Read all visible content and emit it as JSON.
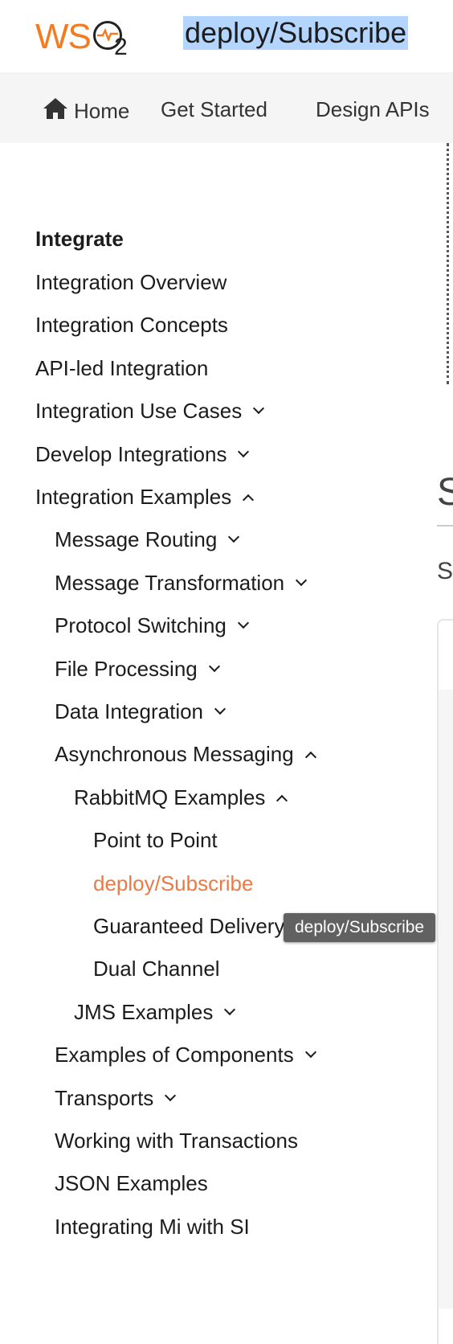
{
  "header": {
    "logo_text": "WSO2",
    "page_title": "deploy/Subscribe"
  },
  "tabs": [
    {
      "label": "Home",
      "icon": "home-icon"
    },
    {
      "label": "Get Started"
    },
    {
      "label": "Design APIs"
    }
  ],
  "sidebar": {
    "heading": "Integrate",
    "items": [
      {
        "label": "Integration Overview",
        "level": 0,
        "chevron": "none"
      },
      {
        "label": "Integration Concepts",
        "level": 0,
        "chevron": "none"
      },
      {
        "label": "API-led Integration",
        "level": 0,
        "chevron": "none"
      },
      {
        "label": "Integration Use Cases",
        "level": 0,
        "chevron": "down"
      },
      {
        "label": "Develop Integrations",
        "level": 0,
        "chevron": "down"
      },
      {
        "label": "Integration Examples",
        "level": 0,
        "chevron": "up"
      },
      {
        "label": "Message Routing",
        "level": 1,
        "chevron": "down"
      },
      {
        "label": "Message Transformation",
        "level": 1,
        "chevron": "down"
      },
      {
        "label": "Protocol Switching",
        "level": 1,
        "chevron": "down"
      },
      {
        "label": "File Processing",
        "level": 1,
        "chevron": "down"
      },
      {
        "label": "Data Integration",
        "level": 1,
        "chevron": "down"
      },
      {
        "label": "Asynchronous Messaging",
        "level": 1,
        "chevron": "up"
      },
      {
        "label": "RabbitMQ Examples",
        "level": 2,
        "chevron": "up"
      },
      {
        "label": "Point to Point",
        "level": 3,
        "chevron": "none"
      },
      {
        "label": "deploy/Subscribe",
        "level": 3,
        "chevron": "none",
        "active": true
      },
      {
        "label": "Guaranteed Delivery",
        "level": 3,
        "chevron": "none"
      },
      {
        "label": "Dual Channel",
        "level": 3,
        "chevron": "none"
      },
      {
        "label": "JMS Examples",
        "level": 2,
        "chevron": "down"
      },
      {
        "label": "Examples of Components",
        "level": 1,
        "chevron": "down"
      },
      {
        "label": "Transports",
        "level": 1,
        "chevron": "down"
      },
      {
        "label": "Working with Transactions",
        "level": 1,
        "chevron": "none"
      },
      {
        "label": "JSON Examples",
        "level": 1,
        "chevron": "none"
      },
      {
        "label": "Integrating Mi with SI",
        "level": 1,
        "chevron": "none"
      }
    ]
  },
  "tooltip": {
    "text": "deploy/Subscribe"
  },
  "content": {
    "heading_fragment": "S",
    "subheading_fragment": "S"
  },
  "colors": {
    "brand": "#f47b20",
    "active_link": "#ea7a45",
    "selection": "#b4d5fe"
  }
}
